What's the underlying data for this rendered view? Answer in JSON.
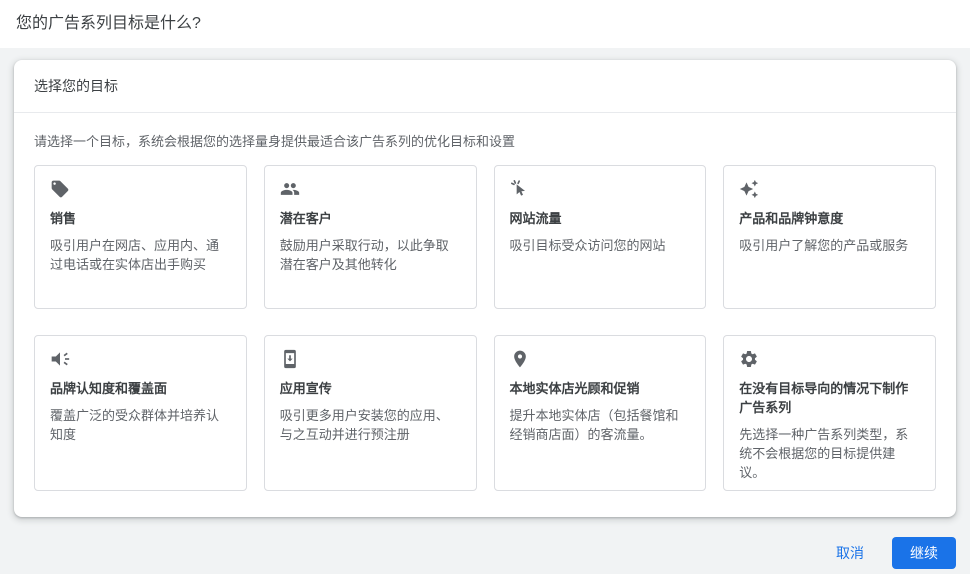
{
  "page": {
    "title": "您的广告系列目标是什么?",
    "background_color": "#f1f3f4",
    "accent_color": "#1a73e8",
    "icon_color": "#5f6368"
  },
  "panel": {
    "header": "选择您的目标",
    "subtitle": "请选择一个目标，系统会根据您的选择量身提供最适合该广告系列的优化目标和设置",
    "goals": [
      {
        "icon": "tag-icon",
        "title": "销售",
        "description": "吸引用户在网店、应用内、通过电话或在实体店出手购买"
      },
      {
        "icon": "people-icon",
        "title": "潜在客户",
        "description": "鼓励用户采取行动，以此争取潜在客户及其他转化"
      },
      {
        "icon": "cursor-click-icon",
        "title": "网站流量",
        "description": "吸引目标受众访问您的网站"
      },
      {
        "icon": "sparkles-icon",
        "title": "产品和品牌钟意度",
        "description": "吸引用户了解您的产品或服务"
      },
      {
        "icon": "megaphone-icon",
        "title": "品牌认知度和覆盖面",
        "description": "覆盖广泛的受众群体并培养认知度"
      },
      {
        "icon": "phone-install-icon",
        "title": "应用宣传",
        "description": "吸引更多用户安装您的应用、与之互动并进行预注册"
      },
      {
        "icon": "location-pin-icon",
        "title": "本地实体店光顾和促销",
        "description": "提升本地实体店（包括餐馆和经销商店面）的客流量。"
      },
      {
        "icon": "gear-icon",
        "title": "在没有目标导向的情况下制作广告系列",
        "description": "先选择一种广告系列类型，系统不会根据您的目标提供建议。"
      }
    ]
  },
  "footer": {
    "cancel_label": "取消",
    "continue_label": "继续"
  }
}
